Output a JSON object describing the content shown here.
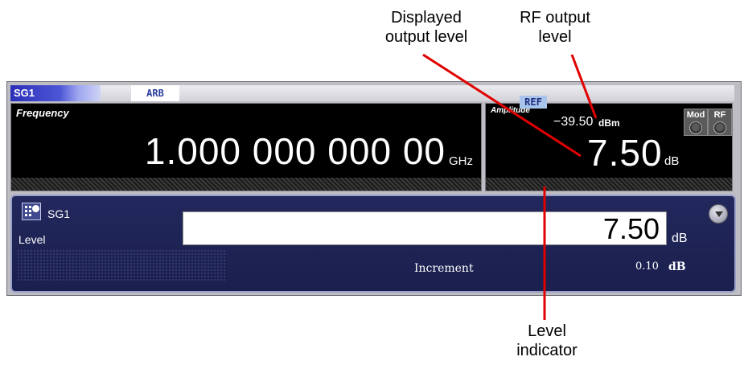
{
  "callouts": {
    "displayed_level_line1": "Displayed",
    "displayed_level_line2": "output level",
    "rf_output_line1": "RF output",
    "rf_output_line2": "level",
    "level_indicator_line1": "Level",
    "level_indicator_line2": "indicator"
  },
  "tabs": {
    "sg1": "SG1",
    "arb": "ARB"
  },
  "frequency": {
    "label": "Frequency",
    "value": "1.000 000 000 00",
    "unit": "GHz"
  },
  "amplitude": {
    "label": "Amplitude",
    "rf_level": "−39.50",
    "rf_level_unit": "dBm",
    "displayed_level": "7.50",
    "displayed_unit": "dB",
    "mod_label": "Mod",
    "rf_label": "RF"
  },
  "ref_badge": "REF",
  "editor": {
    "title": "SG1",
    "param_label": "Level",
    "value": "7.50",
    "value_unit": "dB",
    "increment_label": "Increment",
    "increment_value": "0.10",
    "increment_unit": "dB"
  },
  "icons": {
    "keypad": "keypad-icon",
    "down": "down-arrow-icon",
    "mod_toggle": "toggle-icon",
    "rf_toggle": "toggle-icon"
  },
  "colors": {
    "tab_accent": "#2b2fb8",
    "display_bg": "#000000",
    "editor_bg": "#1a1f4e",
    "ref_badge_bg": "#a8c4ea",
    "callout_line": "#e00000"
  }
}
